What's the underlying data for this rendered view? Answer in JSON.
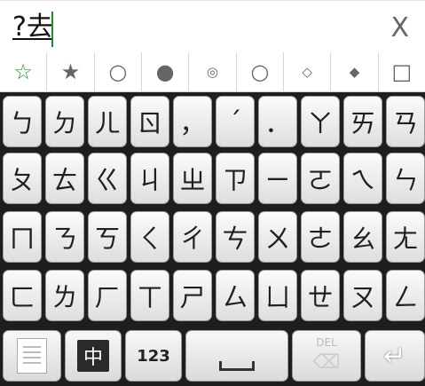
{
  "composing": {
    "text": "?去",
    "close_label": "X"
  },
  "candidates": [
    "☆",
    "★",
    "○",
    "●",
    "◎",
    "○",
    "◇",
    "◆",
    "□"
  ],
  "keyboard": {
    "rows": [
      [
        "ㄅ",
        "ㄉ",
        "ㄦ",
        "ㄖ",
        "，",
        "ˊ",
        "．",
        "ㄚ",
        "ㄞ",
        "ㄢ"
      ],
      [
        "ㄆ",
        "ㄊ",
        "ㄍ",
        "ㄐ",
        "ㄓ",
        "ㄗ",
        "ㄧ",
        "ㄛ",
        "ㄟ",
        "ㄣ"
      ],
      [
        "ㄇ",
        "ㄋ",
        "ㄎ",
        "ㄑ",
        "ㄔ",
        "ㄘ",
        "ㄨ",
        "ㄜ",
        "ㄠ",
        "ㄤ"
      ],
      [
        "ㄈ",
        "ㄌ",
        "ㄏ",
        "ㄒ",
        "ㄕ",
        "ㄙ",
        "ㄩ",
        "ㄝ",
        "ㄡ",
        "ㄥ"
      ]
    ],
    "bottom": {
      "lang_label": "中",
      "num_label": "123",
      "del_label": "DEL"
    }
  },
  "colors": {
    "accent": "#1f9a2b",
    "caret": "#1c8e2e"
  },
  "icons": [
    "clipboard-icon",
    "language-icon",
    "space-icon",
    "delete-icon",
    "enter-icon"
  ]
}
